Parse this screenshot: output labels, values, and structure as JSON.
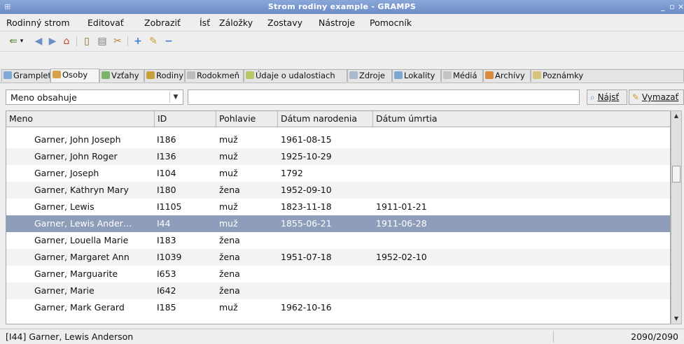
{
  "window": {
    "title": "Strom rodiny example - GRAMPS",
    "controls": "_ ▫ ×"
  },
  "menu": [
    "Rodinný strom",
    "Editovať",
    "Zobraziť",
    "Ísť",
    "Záložky",
    "Zostavy",
    "Nástroje",
    "Pomocník"
  ],
  "toolbar_icons": [
    "person-add-icon",
    "dropdown-arrow-icon",
    "back-arrow-icon",
    "forward-arrow-icon",
    "home-icon",
    "clipboard-icon",
    "notes-icon",
    "tools-icon",
    "add-icon",
    "edit-icon",
    "remove-icon"
  ],
  "tabs": [
    {
      "label": "Gramplety",
      "color": "#7fa9d6"
    },
    {
      "label": "Osoby",
      "color": "#d8a24a"
    },
    {
      "label": "Vzťahy",
      "color": "#7bb36b"
    },
    {
      "label": "Rodiny",
      "color": "#c9a13b"
    },
    {
      "label": "Rodokmeň",
      "color": "#bdbdbd"
    },
    {
      "label": "Údaje o udalostiach",
      "color": "#b7c76a"
    },
    {
      "label": "Zdroje",
      "color": "#aab8cc"
    },
    {
      "label": "Lokality",
      "color": "#7ea7d4"
    },
    {
      "label": "Médiá",
      "color": "#c4c4c4"
    },
    {
      "label": "Archívy",
      "color": "#d98a3a"
    },
    {
      "label": "Poznámky",
      "color": "#d7c37a"
    }
  ],
  "active_tab": "Osoby",
  "filter": {
    "field_label": "Meno obsahuje",
    "value": "",
    "find_label": "Nájsť",
    "clear_label": "Vymazať"
  },
  "columns": [
    "Meno",
    "ID",
    "Pohlavie",
    "Dátum narodenia",
    "Dátum úmrtia"
  ],
  "rows": [
    {
      "name": "Garner, John Joseph",
      "id": "I186",
      "gender": "muž",
      "birth": "1961-08-15",
      "death": ""
    },
    {
      "name": "Garner, John Roger",
      "id": "I136",
      "gender": "muž",
      "birth": "1925-10-29",
      "death": ""
    },
    {
      "name": "Garner, Joseph",
      "id": "I104",
      "gender": "muž",
      "birth": "1792",
      "death": ""
    },
    {
      "name": "Garner, Kathryn Mary",
      "id": "I180",
      "gender": "žena",
      "birth": "1952-09-10",
      "death": ""
    },
    {
      "name": "Garner, Lewis",
      "id": "I1105",
      "gender": "muž",
      "birth": "1823-11-18",
      "death": "1911-01-21"
    },
    {
      "name": "Garner, Lewis Ander…",
      "id": "I44",
      "gender": "muž",
      "birth": "1855-06-21",
      "death": "1911-06-28",
      "selected": true
    },
    {
      "name": "Garner, Louella Marie",
      "id": "I183",
      "gender": "žena",
      "birth": "",
      "death": ""
    },
    {
      "name": "Garner, Margaret Ann",
      "id": "I1039",
      "gender": "žena",
      "birth": "1951-07-18",
      "death": "1952-02-10"
    },
    {
      "name": "Garner, Marguarite",
      "id": "I653",
      "gender": "žena",
      "birth": "",
      "death": ""
    },
    {
      "name": "Garner, Marie",
      "id": "I642",
      "gender": "žena",
      "birth": "",
      "death": ""
    },
    {
      "name": "Garner, Mark Gerard",
      "id": "I185",
      "gender": "muž",
      "birth": "1962-10-16",
      "death": ""
    }
  ],
  "status": {
    "selected_person": "[I44] Garner, Lewis Anderson",
    "count": "2090/2090"
  }
}
